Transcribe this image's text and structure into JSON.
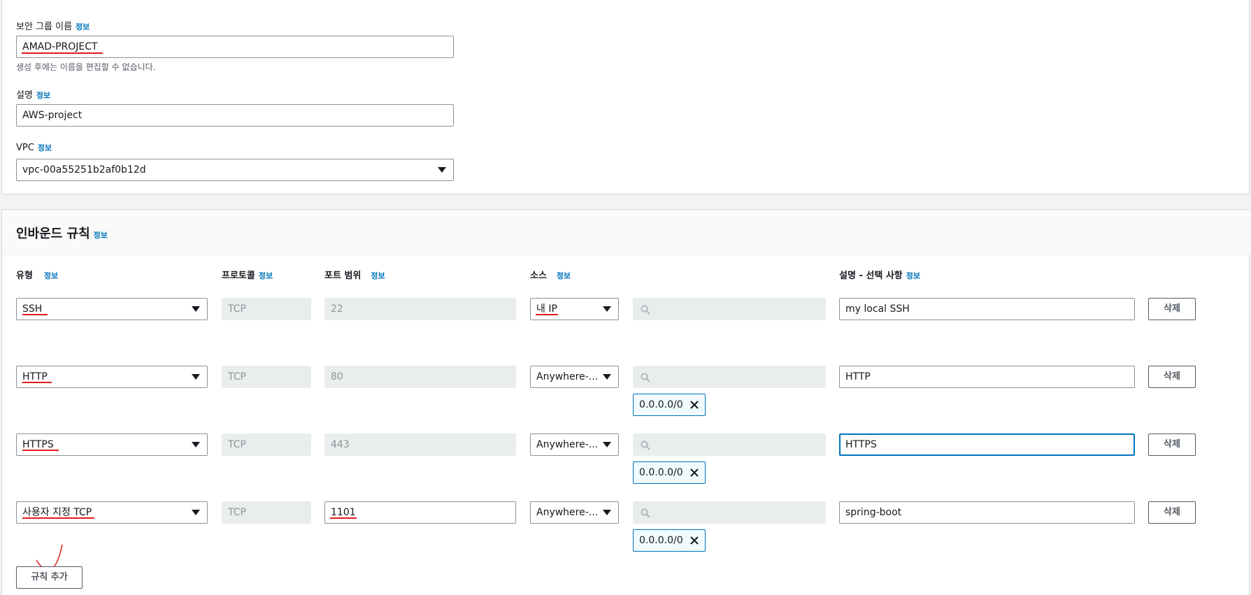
{
  "basic": {
    "sg_name_label": "보안 그룹 이름",
    "sg_name_info": "정보",
    "sg_name_value": "AMAD-PROJECT",
    "sg_name_hint": "생성 후에는 이름을 편집할 수 없습니다.",
    "desc_label": "설명",
    "desc_info": "정보",
    "desc_value": "AWS-project",
    "vpc_label": "VPC",
    "vpc_info": "정보",
    "vpc_value": "vpc-00a55251b2af0b12d"
  },
  "inbound": {
    "title": "인바운드 규칙",
    "title_info": "정보",
    "headers": {
      "type": "유형",
      "type_info": "정보",
      "protocol": "프로토콜",
      "protocol_info": "정보",
      "port": "포트 범위",
      "port_info": "정보",
      "source": "소스",
      "source_info": "정보",
      "desc": "설명 - 선택 사항",
      "desc_info": "정보"
    },
    "rules": [
      {
        "type": "SSH",
        "protocol": "TCP",
        "port": "22",
        "source": "내 IP",
        "search": "",
        "cidr": "",
        "description": "my local SSH",
        "delete": "삭제"
      },
      {
        "type": "HTTP",
        "protocol": "TCP",
        "port": "80",
        "source": "Anywhere-...",
        "search": "",
        "cidr": "0.0.0.0/0",
        "description": "HTTP",
        "delete": "삭제"
      },
      {
        "type": "HTTPS",
        "protocol": "TCP",
        "port": "443",
        "source": "Anywhere-...",
        "search": "",
        "cidr": "0.0.0.0/0",
        "description": "HTTPS",
        "delete": "삭제"
      },
      {
        "type": "사용자 지정 TCP",
        "protocol": "TCP",
        "port": "1101",
        "source": "Anywhere-...",
        "search": "",
        "cidr": "0.0.0.0/0",
        "description": "spring-boot",
        "delete": "삭제"
      }
    ],
    "add_rule": "규칙 추가"
  },
  "colors": {
    "accent": "#0073bb",
    "annotation": "#e11b1b"
  },
  "icons": [
    "chevron-down-icon",
    "search-icon",
    "close-icon"
  ]
}
